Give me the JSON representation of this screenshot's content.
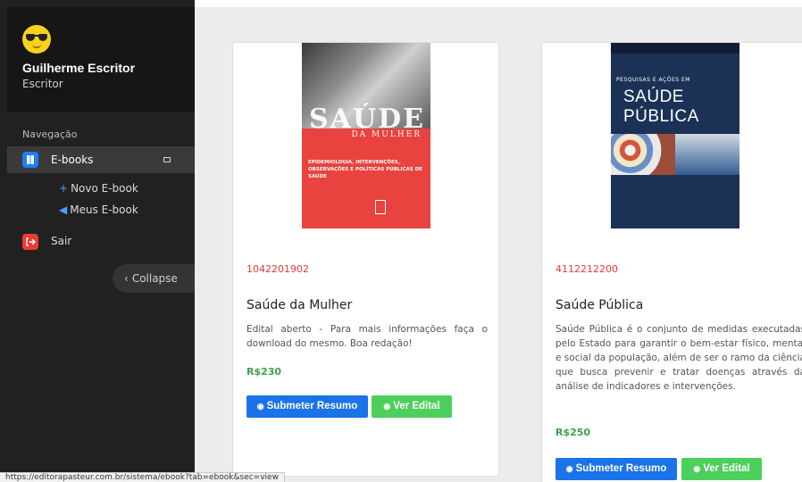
{
  "sidebar": {
    "profile": {
      "name": "Guilherme Escritor",
      "role": "Escritor"
    },
    "nav_heading": "Navegação",
    "items": [
      {
        "label": "E-books",
        "active": true,
        "icon": "book-icon"
      },
      {
        "label": "Sair",
        "active": false,
        "icon": "logout-icon"
      }
    ],
    "submenu": [
      {
        "mark": "+",
        "label": "Novo E-book"
      },
      {
        "mark": "◀",
        "label": "Meus E-book"
      }
    ],
    "collapse_label": "Collapse"
  },
  "books": [
    {
      "cover": {
        "title": "SAÚDE",
        "subtitle": "DA MULHER",
        "desc": "EPIDEMIOLOGIA, INTERVENÇÕES, OBSERVAÇÕES E POLÍTICAS PÚBLICAS DE SAÚDE"
      },
      "code": "1042201902",
      "title": "Saúde da Mulher",
      "description": "Edital aberto - Para mais informações faça o download do mesmo. Boa redação!",
      "price": "R$230",
      "submit_label": "Submeter Resumo",
      "view_label": "Ver Edital"
    },
    {
      "cover": {
        "pre": "PESQUISAS E AÇÕES EM",
        "title": "SAÚDE PÚBLICA"
      },
      "code": "4112212200",
      "title": "Saúde Pública",
      "description": "Saúde Pública é o conjunto de medidas executadas pelo Estado para garantir o bem-estar físico, mental e social da população, além de ser o ramo da ciência que busca prevenir e tratar doenças através da análise de indicadores e intervenções.",
      "price": "R$250",
      "submit_label": "Submeter Resumo",
      "view_label": "Ver Edital"
    }
  ],
  "status_bar": {
    "url": "https://editorapasteur.com.br/sistema/ebook?tab=ebook&sec=view"
  },
  "colors": {
    "sidebar": "#212121",
    "accent_blue": "#1a73e8",
    "accent_green": "#4ccf5b",
    "code_red": "#e53935"
  }
}
